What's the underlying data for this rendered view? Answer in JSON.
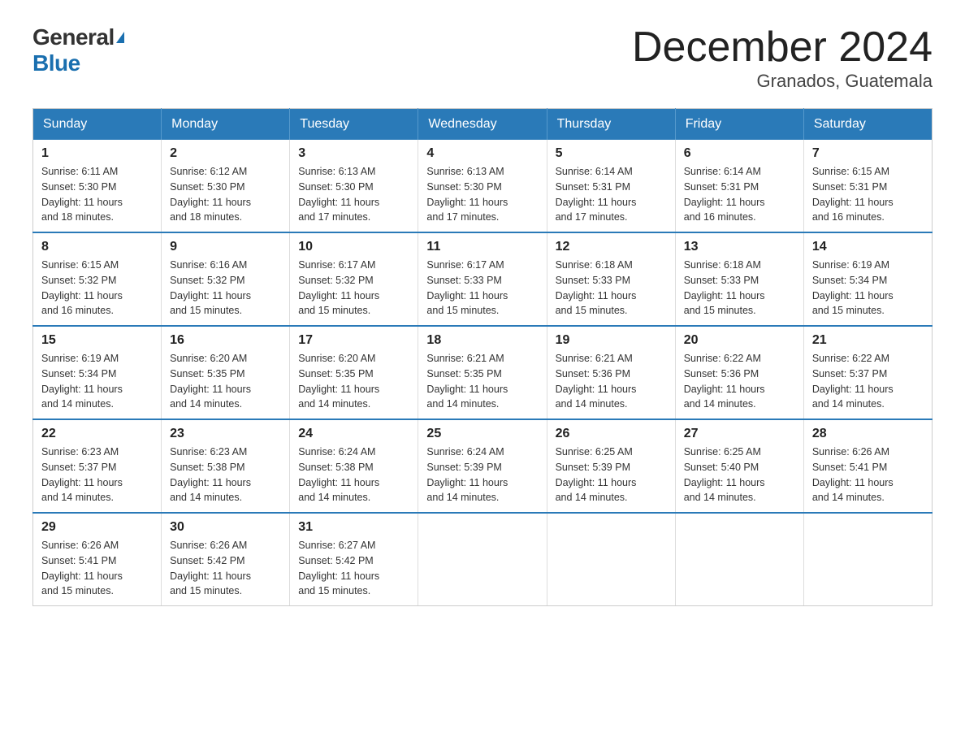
{
  "logo": {
    "general": "General",
    "blue": "Blue"
  },
  "title": "December 2024",
  "subtitle": "Granados, Guatemala",
  "days_of_week": [
    "Sunday",
    "Monday",
    "Tuesday",
    "Wednesday",
    "Thursday",
    "Friday",
    "Saturday"
  ],
  "weeks": [
    [
      {
        "day": "1",
        "sunrise": "6:11 AM",
        "sunset": "5:30 PM",
        "daylight": "11 hours and 18 minutes."
      },
      {
        "day": "2",
        "sunrise": "6:12 AM",
        "sunset": "5:30 PM",
        "daylight": "11 hours and 18 minutes."
      },
      {
        "day": "3",
        "sunrise": "6:13 AM",
        "sunset": "5:30 PM",
        "daylight": "11 hours and 17 minutes."
      },
      {
        "day": "4",
        "sunrise": "6:13 AM",
        "sunset": "5:30 PM",
        "daylight": "11 hours and 17 minutes."
      },
      {
        "day": "5",
        "sunrise": "6:14 AM",
        "sunset": "5:31 PM",
        "daylight": "11 hours and 17 minutes."
      },
      {
        "day": "6",
        "sunrise": "6:14 AM",
        "sunset": "5:31 PM",
        "daylight": "11 hours and 16 minutes."
      },
      {
        "day": "7",
        "sunrise": "6:15 AM",
        "sunset": "5:31 PM",
        "daylight": "11 hours and 16 minutes."
      }
    ],
    [
      {
        "day": "8",
        "sunrise": "6:15 AM",
        "sunset": "5:32 PM",
        "daylight": "11 hours and 16 minutes."
      },
      {
        "day": "9",
        "sunrise": "6:16 AM",
        "sunset": "5:32 PM",
        "daylight": "11 hours and 15 minutes."
      },
      {
        "day": "10",
        "sunrise": "6:17 AM",
        "sunset": "5:32 PM",
        "daylight": "11 hours and 15 minutes."
      },
      {
        "day": "11",
        "sunrise": "6:17 AM",
        "sunset": "5:33 PM",
        "daylight": "11 hours and 15 minutes."
      },
      {
        "day": "12",
        "sunrise": "6:18 AM",
        "sunset": "5:33 PM",
        "daylight": "11 hours and 15 minutes."
      },
      {
        "day": "13",
        "sunrise": "6:18 AM",
        "sunset": "5:33 PM",
        "daylight": "11 hours and 15 minutes."
      },
      {
        "day": "14",
        "sunrise": "6:19 AM",
        "sunset": "5:34 PM",
        "daylight": "11 hours and 15 minutes."
      }
    ],
    [
      {
        "day": "15",
        "sunrise": "6:19 AM",
        "sunset": "5:34 PM",
        "daylight": "11 hours and 14 minutes."
      },
      {
        "day": "16",
        "sunrise": "6:20 AM",
        "sunset": "5:35 PM",
        "daylight": "11 hours and 14 minutes."
      },
      {
        "day": "17",
        "sunrise": "6:20 AM",
        "sunset": "5:35 PM",
        "daylight": "11 hours and 14 minutes."
      },
      {
        "day": "18",
        "sunrise": "6:21 AM",
        "sunset": "5:35 PM",
        "daylight": "11 hours and 14 minutes."
      },
      {
        "day": "19",
        "sunrise": "6:21 AM",
        "sunset": "5:36 PM",
        "daylight": "11 hours and 14 minutes."
      },
      {
        "day": "20",
        "sunrise": "6:22 AM",
        "sunset": "5:36 PM",
        "daylight": "11 hours and 14 minutes."
      },
      {
        "day": "21",
        "sunrise": "6:22 AM",
        "sunset": "5:37 PM",
        "daylight": "11 hours and 14 minutes."
      }
    ],
    [
      {
        "day": "22",
        "sunrise": "6:23 AM",
        "sunset": "5:37 PM",
        "daylight": "11 hours and 14 minutes."
      },
      {
        "day": "23",
        "sunrise": "6:23 AM",
        "sunset": "5:38 PM",
        "daylight": "11 hours and 14 minutes."
      },
      {
        "day": "24",
        "sunrise": "6:24 AM",
        "sunset": "5:38 PM",
        "daylight": "11 hours and 14 minutes."
      },
      {
        "day": "25",
        "sunrise": "6:24 AM",
        "sunset": "5:39 PM",
        "daylight": "11 hours and 14 minutes."
      },
      {
        "day": "26",
        "sunrise": "6:25 AM",
        "sunset": "5:39 PM",
        "daylight": "11 hours and 14 minutes."
      },
      {
        "day": "27",
        "sunrise": "6:25 AM",
        "sunset": "5:40 PM",
        "daylight": "11 hours and 14 minutes."
      },
      {
        "day": "28",
        "sunrise": "6:26 AM",
        "sunset": "5:41 PM",
        "daylight": "11 hours and 14 minutes."
      }
    ],
    [
      {
        "day": "29",
        "sunrise": "6:26 AM",
        "sunset": "5:41 PM",
        "daylight": "11 hours and 15 minutes."
      },
      {
        "day": "30",
        "sunrise": "6:26 AM",
        "sunset": "5:42 PM",
        "daylight": "11 hours and 15 minutes."
      },
      {
        "day": "31",
        "sunrise": "6:27 AM",
        "sunset": "5:42 PM",
        "daylight": "11 hours and 15 minutes."
      },
      null,
      null,
      null,
      null
    ]
  ],
  "labels": {
    "sunrise": "Sunrise:",
    "sunset": "Sunset:",
    "daylight": "Daylight:"
  }
}
